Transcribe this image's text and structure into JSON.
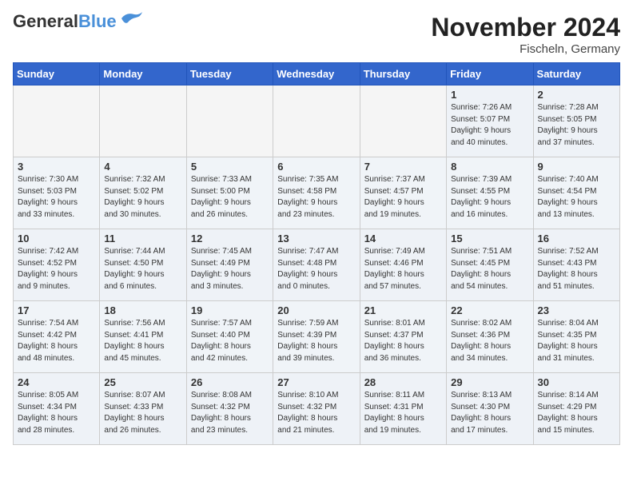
{
  "header": {
    "logo_general": "General",
    "logo_blue": "Blue",
    "month": "November 2024",
    "location": "Fischeln, Germany"
  },
  "weekdays": [
    "Sunday",
    "Monday",
    "Tuesday",
    "Wednesday",
    "Thursday",
    "Friday",
    "Saturday"
  ],
  "weeks": [
    [
      {
        "day": "",
        "info": ""
      },
      {
        "day": "",
        "info": ""
      },
      {
        "day": "",
        "info": ""
      },
      {
        "day": "",
        "info": ""
      },
      {
        "day": "",
        "info": ""
      },
      {
        "day": "1",
        "info": "Sunrise: 7:26 AM\nSunset: 5:07 PM\nDaylight: 9 hours\nand 40 minutes."
      },
      {
        "day": "2",
        "info": "Sunrise: 7:28 AM\nSunset: 5:05 PM\nDaylight: 9 hours\nand 37 minutes."
      }
    ],
    [
      {
        "day": "3",
        "info": "Sunrise: 7:30 AM\nSunset: 5:03 PM\nDaylight: 9 hours\nand 33 minutes."
      },
      {
        "day": "4",
        "info": "Sunrise: 7:32 AM\nSunset: 5:02 PM\nDaylight: 9 hours\nand 30 minutes."
      },
      {
        "day": "5",
        "info": "Sunrise: 7:33 AM\nSunset: 5:00 PM\nDaylight: 9 hours\nand 26 minutes."
      },
      {
        "day": "6",
        "info": "Sunrise: 7:35 AM\nSunset: 4:58 PM\nDaylight: 9 hours\nand 23 minutes."
      },
      {
        "day": "7",
        "info": "Sunrise: 7:37 AM\nSunset: 4:57 PM\nDaylight: 9 hours\nand 19 minutes."
      },
      {
        "day": "8",
        "info": "Sunrise: 7:39 AM\nSunset: 4:55 PM\nDaylight: 9 hours\nand 16 minutes."
      },
      {
        "day": "9",
        "info": "Sunrise: 7:40 AM\nSunset: 4:54 PM\nDaylight: 9 hours\nand 13 minutes."
      }
    ],
    [
      {
        "day": "10",
        "info": "Sunrise: 7:42 AM\nSunset: 4:52 PM\nDaylight: 9 hours\nand 9 minutes."
      },
      {
        "day": "11",
        "info": "Sunrise: 7:44 AM\nSunset: 4:50 PM\nDaylight: 9 hours\nand 6 minutes."
      },
      {
        "day": "12",
        "info": "Sunrise: 7:45 AM\nSunset: 4:49 PM\nDaylight: 9 hours\nand 3 minutes."
      },
      {
        "day": "13",
        "info": "Sunrise: 7:47 AM\nSunset: 4:48 PM\nDaylight: 9 hours\nand 0 minutes."
      },
      {
        "day": "14",
        "info": "Sunrise: 7:49 AM\nSunset: 4:46 PM\nDaylight: 8 hours\nand 57 minutes."
      },
      {
        "day": "15",
        "info": "Sunrise: 7:51 AM\nSunset: 4:45 PM\nDaylight: 8 hours\nand 54 minutes."
      },
      {
        "day": "16",
        "info": "Sunrise: 7:52 AM\nSunset: 4:43 PM\nDaylight: 8 hours\nand 51 minutes."
      }
    ],
    [
      {
        "day": "17",
        "info": "Sunrise: 7:54 AM\nSunset: 4:42 PM\nDaylight: 8 hours\nand 48 minutes."
      },
      {
        "day": "18",
        "info": "Sunrise: 7:56 AM\nSunset: 4:41 PM\nDaylight: 8 hours\nand 45 minutes."
      },
      {
        "day": "19",
        "info": "Sunrise: 7:57 AM\nSunset: 4:40 PM\nDaylight: 8 hours\nand 42 minutes."
      },
      {
        "day": "20",
        "info": "Sunrise: 7:59 AM\nSunset: 4:39 PM\nDaylight: 8 hours\nand 39 minutes."
      },
      {
        "day": "21",
        "info": "Sunrise: 8:01 AM\nSunset: 4:37 PM\nDaylight: 8 hours\nand 36 minutes."
      },
      {
        "day": "22",
        "info": "Sunrise: 8:02 AM\nSunset: 4:36 PM\nDaylight: 8 hours\nand 34 minutes."
      },
      {
        "day": "23",
        "info": "Sunrise: 8:04 AM\nSunset: 4:35 PM\nDaylight: 8 hours\nand 31 minutes."
      }
    ],
    [
      {
        "day": "24",
        "info": "Sunrise: 8:05 AM\nSunset: 4:34 PM\nDaylight: 8 hours\nand 28 minutes."
      },
      {
        "day": "25",
        "info": "Sunrise: 8:07 AM\nSunset: 4:33 PM\nDaylight: 8 hours\nand 26 minutes."
      },
      {
        "day": "26",
        "info": "Sunrise: 8:08 AM\nSunset: 4:32 PM\nDaylight: 8 hours\nand 23 minutes."
      },
      {
        "day": "27",
        "info": "Sunrise: 8:10 AM\nSunset: 4:32 PM\nDaylight: 8 hours\nand 21 minutes."
      },
      {
        "day": "28",
        "info": "Sunrise: 8:11 AM\nSunset: 4:31 PM\nDaylight: 8 hours\nand 19 minutes."
      },
      {
        "day": "29",
        "info": "Sunrise: 8:13 AM\nSunset: 4:30 PM\nDaylight: 8 hours\nand 17 minutes."
      },
      {
        "day": "30",
        "info": "Sunrise: 8:14 AM\nSunset: 4:29 PM\nDaylight: 8 hours\nand 15 minutes."
      }
    ]
  ]
}
